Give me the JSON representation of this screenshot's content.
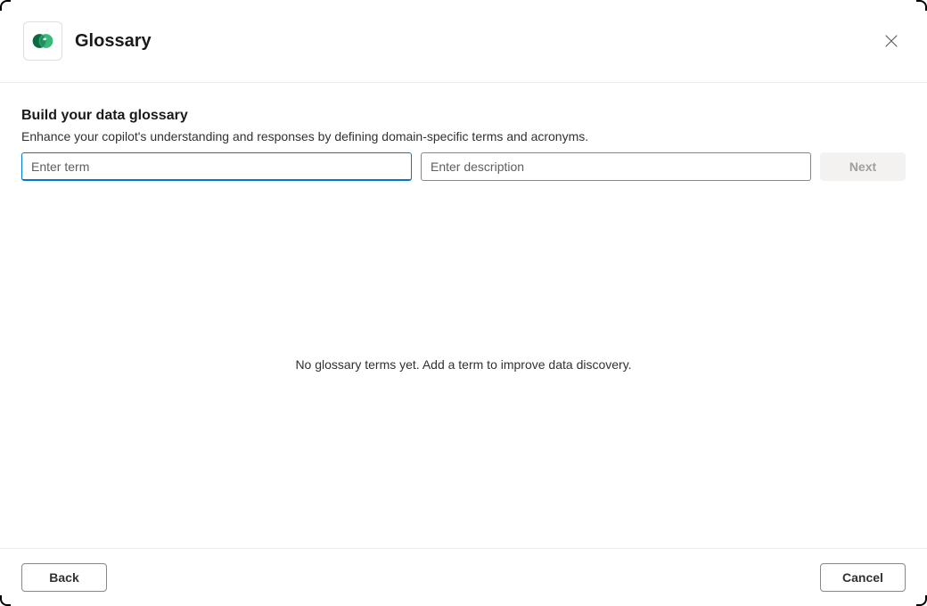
{
  "header": {
    "title": "Glossary"
  },
  "section": {
    "title": "Build your data glossary",
    "description": "Enhance your copilot's understanding and responses by defining domain-specific terms and acronyms."
  },
  "form": {
    "term_placeholder": "Enter term",
    "term_value": "",
    "description_placeholder": "Enter description",
    "description_value": "",
    "next_label": "Next"
  },
  "empty_state": {
    "text": "No glossary terms yet. Add a term to improve data discovery."
  },
  "footer": {
    "back_label": "Back",
    "cancel_label": "Cancel"
  }
}
